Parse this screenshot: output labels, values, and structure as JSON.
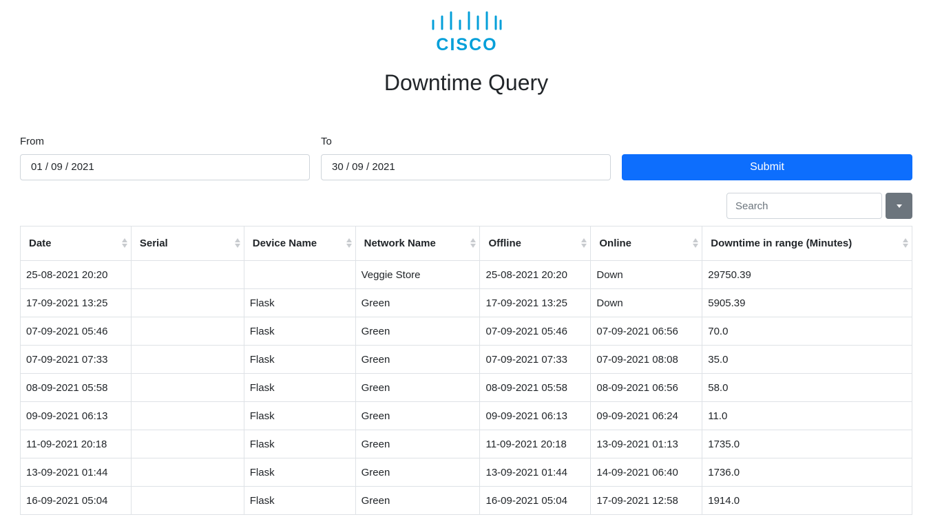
{
  "brand": {
    "logo_text": "CISCO",
    "logo_color": "#049fd9"
  },
  "page": {
    "title": "Downtime Query"
  },
  "form": {
    "from_label": "From",
    "from_value": "01 / 09 / 2021",
    "to_label": "To",
    "to_value": "30 / 09 / 2021",
    "submit_label": "Submit"
  },
  "toolbar": {
    "search_placeholder": "Search",
    "toggle_icon": "caret-down-icon"
  },
  "colors": {
    "primary": "#0d6efd",
    "secondary": "#6c757d",
    "border": "#dee2e6"
  },
  "table": {
    "columns": [
      "Date",
      "Serial",
      "Device Name",
      "Network Name",
      "Offline",
      "Online",
      "Downtime in range (Minutes)"
    ],
    "rows": [
      [
        "25-08-2021 20:20",
        "",
        "",
        "Veggie Store",
        "25-08-2021 20:20",
        "Down",
        "29750.39"
      ],
      [
        "17-09-2021 13:25",
        "",
        "Flask",
        "Green",
        "17-09-2021 13:25",
        "Down",
        "5905.39"
      ],
      [
        "07-09-2021 05:46",
        "",
        "Flask",
        "Green",
        "07-09-2021 05:46",
        "07-09-2021 06:56",
        "70.0"
      ],
      [
        "07-09-2021 07:33",
        "",
        "Flask",
        "Green",
        "07-09-2021 07:33",
        "07-09-2021 08:08",
        "35.0"
      ],
      [
        "08-09-2021 05:58",
        "",
        "Flask",
        "Green",
        "08-09-2021 05:58",
        "08-09-2021 06:56",
        "58.0"
      ],
      [
        "09-09-2021 06:13",
        "",
        "Flask",
        "Green",
        "09-09-2021 06:13",
        "09-09-2021 06:24",
        "11.0"
      ],
      [
        "11-09-2021 20:18",
        "",
        "Flask",
        "Green",
        "11-09-2021 20:18",
        "13-09-2021 01:13",
        "1735.0"
      ],
      [
        "13-09-2021 01:44",
        "",
        "Flask",
        "Green",
        "13-09-2021 01:44",
        "14-09-2021 06:40",
        "1736.0"
      ],
      [
        "16-09-2021 05:04",
        "",
        "Flask",
        "Green",
        "16-09-2021 05:04",
        "17-09-2021 12:58",
        "1914.0"
      ]
    ]
  }
}
